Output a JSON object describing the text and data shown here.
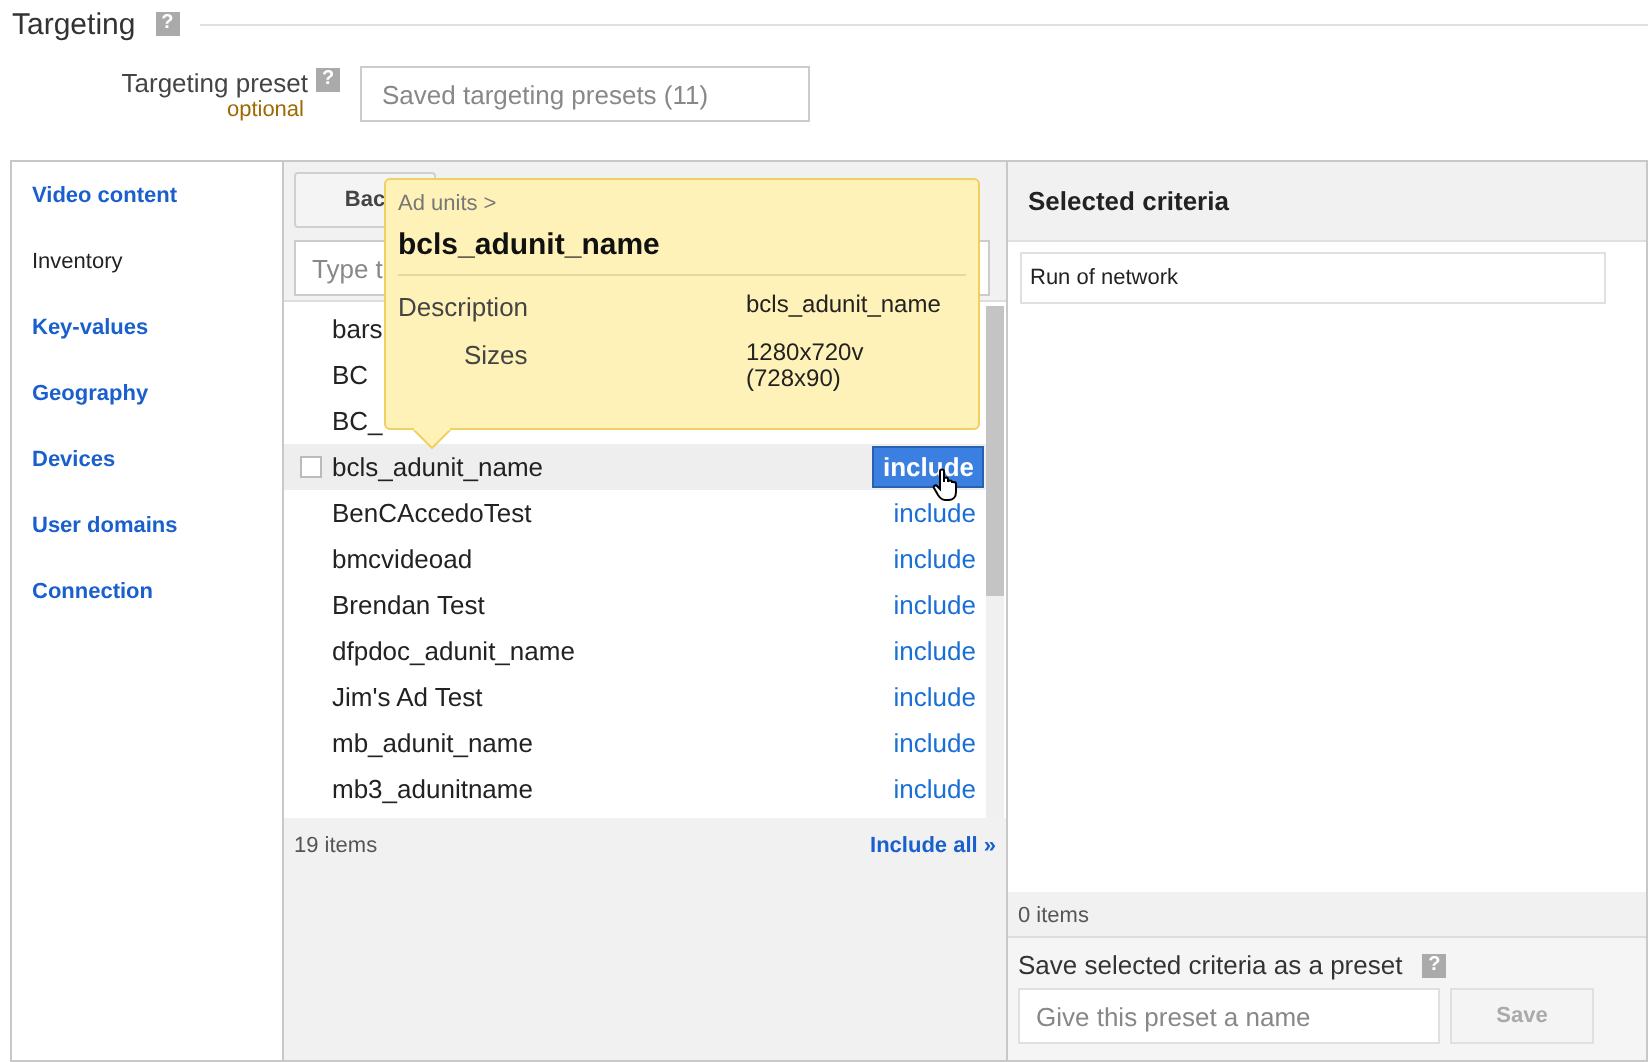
{
  "section": {
    "title": "Targeting",
    "help": "?"
  },
  "preset": {
    "label": "Targeting preset",
    "help": "?",
    "note": "optional",
    "placeholder": "Saved targeting presets (11)"
  },
  "nav": [
    {
      "label": "Video content",
      "selected": false
    },
    {
      "label": "Inventory",
      "selected": true
    },
    {
      "label": "Key-values",
      "selected": false
    },
    {
      "label": "Geography",
      "selected": false
    },
    {
      "label": "Devices",
      "selected": false
    },
    {
      "label": "User domains",
      "selected": false
    },
    {
      "label": "Connection",
      "selected": false
    }
  ],
  "list": {
    "back": "Bac",
    "search_placeholder": "Type t",
    "rows": [
      {
        "label": "bars",
        "selected": false
      },
      {
        "label": "BC",
        "selected": false
      },
      {
        "label": "BC_",
        "selected": false
      },
      {
        "label": "bcls_adunit_name",
        "action": "include",
        "selected": true
      },
      {
        "label": "BenCAccedoTest",
        "action": "include",
        "selected": false
      },
      {
        "label": "bmcvideoad",
        "action": "include",
        "selected": false
      },
      {
        "label": "Brendan Test",
        "action": "include",
        "selected": false
      },
      {
        "label": "dfpdoc_adunit_name",
        "action": "include",
        "selected": false
      },
      {
        "label": "Jim's Ad Test",
        "action": "include",
        "selected": false
      },
      {
        "label": "mb_adunit_name",
        "action": "include",
        "selected": false
      },
      {
        "label": "mb3_adunitname",
        "action": "include",
        "selected": false
      }
    ],
    "count": "19 items",
    "include_all": "Include all »"
  },
  "tooltip": {
    "breadcrumb": "Ad units >",
    "title": "bcls_adunit_name",
    "fields": [
      {
        "label": "Description",
        "value": "bcls_adunit_name"
      },
      {
        "label": "Sizes",
        "value": "1280x720v (728x90)"
      }
    ]
  },
  "selected_panel": {
    "title": "Selected criteria",
    "items": [
      "Run of network"
    ],
    "count": "0 items",
    "save_label": "Save selected criteria as a preset",
    "help": "?",
    "name_placeholder": "Give this preset a name",
    "save": "Save"
  }
}
